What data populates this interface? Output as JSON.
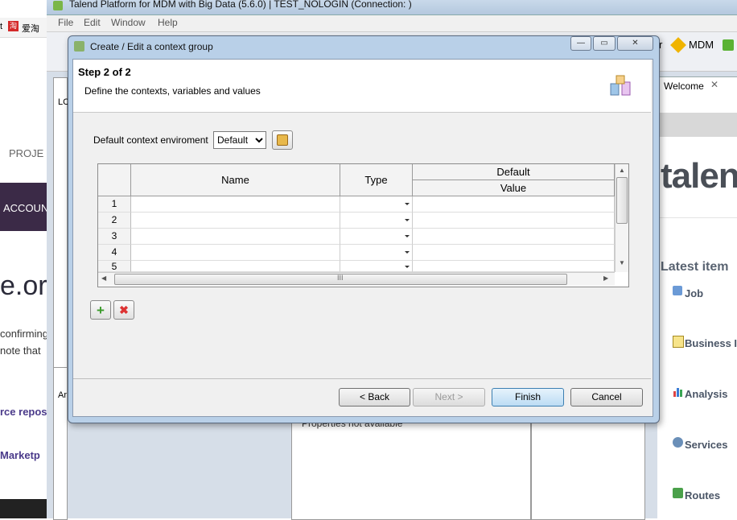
{
  "app": {
    "title": "Talend Platform for MDM with Big Data (5.6.0) | TEST_NOLOGIN (Connection: )",
    "menu": [
      "File",
      "Edit",
      "Window",
      "Help"
    ],
    "toolbar_partial_label": "r",
    "mdm_label": "MDM"
  },
  "browser_bg": {
    "toolbar_text": "t",
    "bookmark_label": "爱淘",
    "proj_text": "PROJE",
    "account_text": "ACCOUN",
    "big_text": "e.or",
    "confirm_text": "confirming",
    "note_text": "note that",
    "repos_text": "rce repos",
    "market_text": "Marketp"
  },
  "left_panel": {
    "label_top": "LC",
    "label_bottom": "Ar"
  },
  "properties_text": "Properties not available",
  "welcome": {
    "tab_label": "Welcome",
    "logo_text": "talen",
    "latest_items_title": "Latest item",
    "items": [
      "Job",
      "Business I",
      "Analysis",
      "Services",
      "Routes"
    ]
  },
  "dialog": {
    "title": "Create / Edit a context group",
    "step_title": "Step 2 of 2",
    "step_desc": "Define the contexts, variables and values",
    "default_ctx_label": "Default context enviroment",
    "default_ctx_value": "Default",
    "table": {
      "headers": {
        "name": "Name",
        "type": "Type",
        "group": "Default",
        "value": "Value"
      },
      "rows": [
        "1",
        "2",
        "3",
        "4",
        "5"
      ],
      "scroll_grip": "III"
    },
    "buttons": {
      "back": "< Back",
      "next": "Next >",
      "finish": "Finish",
      "cancel": "Cancel"
    },
    "accent_color": "#3c7fb1"
  }
}
